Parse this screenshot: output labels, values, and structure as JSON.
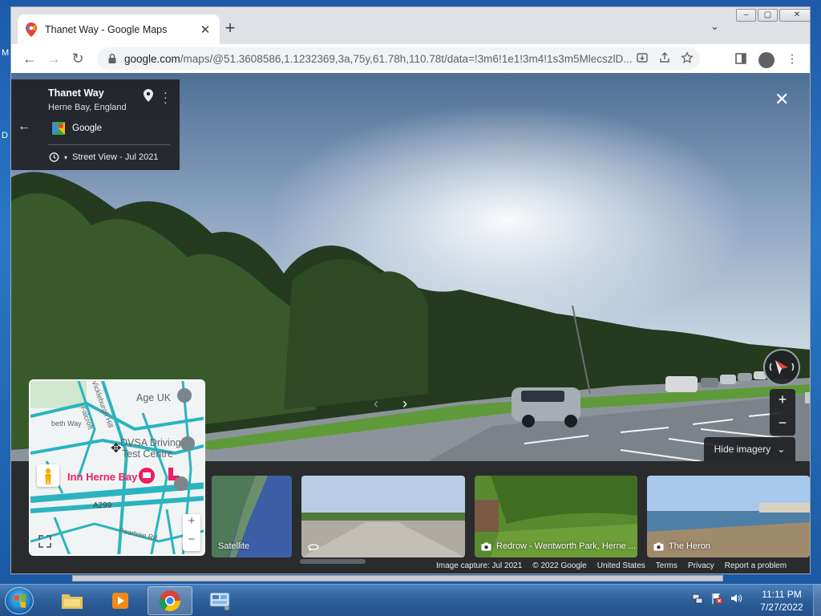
{
  "desktop": {
    "edge_letters": [
      "M",
      "D"
    ]
  },
  "browser": {
    "tab": {
      "title": "Thanet Way - Google Maps",
      "close": "✕"
    },
    "new_tab": "+",
    "tab_search": "⌄",
    "window_controls": {
      "minimize": "–",
      "restore": "▢",
      "close": "✕"
    },
    "toolbar": {
      "back": "←",
      "forward": "→",
      "reload": "↻",
      "url_host": "google.com",
      "url_path": "/maps/@51.3608586,1.1232369,3a,75y,61.78h,110.78t/data=!3m6!1e1!3m4!1s3m5MlecszlD..."
    }
  },
  "streetview": {
    "place_title": "Thanet Way",
    "place_subtitle": "Herne Bay, England",
    "source": "Google",
    "capture_label": "Street View - Jul 2021",
    "close": "✕",
    "nav_prev": "‹",
    "nav_next": "›",
    "zoom_in": "+",
    "zoom_out": "−",
    "hide_imagery": "Hide imagery"
  },
  "minimap": {
    "labels": {
      "poi1": "Age UK",
      "road1": "Vickleburgh Hill",
      "road2": "Falcroft",
      "road3": "beth Way",
      "poi2_line1": "DVSA Driving",
      "poi2_line2": "Test Centre",
      "poi3": "Inn Herne Bay",
      "road4": "A299",
      "road5": "Peartree Rd"
    },
    "zoom_in": "+",
    "zoom_out": "−"
  },
  "thumbnails": [
    {
      "label": "Satellite"
    },
    {
      "label": ""
    },
    {
      "label": "Redrow - Wentworth Park, Herne ..."
    },
    {
      "label": "The Heron"
    }
  ],
  "footer": {
    "items": [
      "Image capture: Jul 2021",
      "© 2022 Google",
      "United States",
      "Terms",
      "Privacy",
      "Report a problem"
    ]
  },
  "taskbar": {
    "apps": [
      "file-explorer",
      "media-player",
      "chrome",
      "control-panel"
    ],
    "active_app": "chrome",
    "time": "11:11 PM",
    "date": "7/27/2022"
  },
  "colors": {
    "accent_blue": "#1a73e8",
    "card_bg": "#202124",
    "minimap_road": "#2bb3c0",
    "poi_pink": "#e91e63"
  }
}
